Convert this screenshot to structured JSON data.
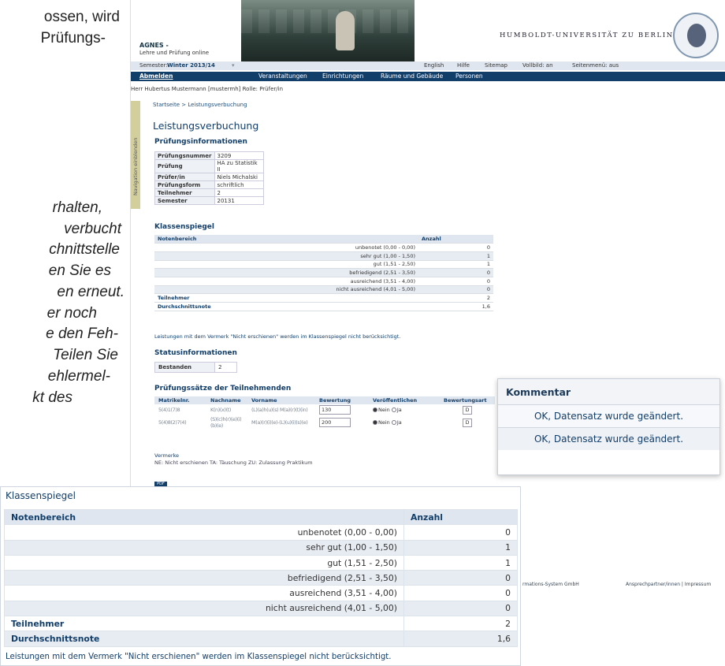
{
  "doc_fragment": {
    "lines": [
      {
        "text": "ossen, wird",
        "style": "normal"
      },
      {
        "text": "Prüfungs-",
        "style": "normal"
      },
      {
        "text": "rhalten,",
        "style": "italic"
      },
      {
        "text": "verbucht",
        "style": "italic"
      },
      {
        "text": "chnittstelle",
        "style": "italic"
      },
      {
        "text": "en Sie es",
        "style": "italic"
      },
      {
        "text": "en erneut.",
        "style": "italic"
      },
      {
        "text": "er noch",
        "style": "italic"
      },
      {
        "text": "e den Feh-",
        "style": "italic"
      },
      {
        "text": "Teilen Sie",
        "style": "italic"
      },
      {
        "text": "ehlermel-",
        "style": "italic"
      },
      {
        "text": "kt des",
        "style": "italic"
      }
    ]
  },
  "header": {
    "app_name": "AGNES -",
    "app_sub": "Lehre und Prüfung online",
    "university": "HUMBOLDT-UNIVERSITÄT ZU BERLIN",
    "semester_label": "Semester:",
    "semester_value": "Winter 2013/14",
    "top_links": [
      "English",
      "Hilfe",
      "Sitemap",
      "Vollbild: an",
      "Seitenmenü: aus"
    ],
    "logout": "Abmelden",
    "nav": [
      "Veranstaltungen",
      "Einrichtungen",
      "Räume und Gebäude",
      "Personen"
    ],
    "user_line": "Herr Hubertus Mustermann [mustermh]  Rolle: Prüfer/in"
  },
  "sidebar_toggle": "Navigation einblenden",
  "breadcrumb": "Startseite > Leistungsverbuchung",
  "page_title": "Leistungsverbuchung",
  "pruefungsinfo": {
    "heading": "Prüfungsinformationen",
    "rows": [
      {
        "k": "Prüfungsnummer",
        "v": "3209"
      },
      {
        "k": "Prüfung",
        "v": "HA zu Statistik II"
      },
      {
        "k": "Prüfer/in",
        "v": "Niels Michalski"
      },
      {
        "k": "Prüfungsform",
        "v": "schriftlich"
      },
      {
        "k": "Teilnehmer",
        "v": "2"
      },
      {
        "k": "Semester",
        "v": "20131"
      }
    ]
  },
  "klassenspiegel": {
    "heading": "Klassenspiegel",
    "col_range": "Notenbereich",
    "col_count": "Anzahl",
    "rows": [
      {
        "range": "unbenotet (0,00 - 0,00)",
        "count": "0"
      },
      {
        "range": "sehr gut (1,00 - 1,50)",
        "count": "1"
      },
      {
        "range": "gut (1,51 - 2,50)",
        "count": "1"
      },
      {
        "range": "befriedigend (2,51 - 3,50)",
        "count": "0"
      },
      {
        "range": "ausreichend (3,51 - 4,00)",
        "count": "0"
      },
      {
        "range": "nicht ausreichend (4,01 - 5,00)",
        "count": "0"
      }
    ],
    "participants_label": "Teilnehmer",
    "participants": "2",
    "avg_label": "Durchschnittsnote",
    "avg": "1,6",
    "note": "Leistungen mit dem Vermerk \"Nicht erschienen\" werden im Klassenspiegel nicht berücksichtigt."
  },
  "status": {
    "heading": "Statusinformationen",
    "label": "Bestanden",
    "value": "2"
  },
  "pruefungssaetze": {
    "heading": "Prüfungssätze der Teilnehmenden",
    "cols": [
      "Matrikelnr.",
      "Nachname",
      "Vorname",
      "Bewertung",
      "Veröffentlichen",
      "Bewertungsart"
    ],
    "rows": [
      {
        "matrikel": "5(4)1(7)8",
        "nachname": "K(n)(x)(t)",
        "vorname": "(L)(a)h(u)(s) M(a)(r)(t)(in)",
        "bewertung": "130"
      },
      {
        "matrikel": "5(4)8(2)7(4)",
        "nachname": "(S)(c)h(r)(e)(i)(b)(e)",
        "vorname": "M(a)(r)(i)(e)-(L)(u)(i)(s)(e)",
        "bewertung": "200"
      }
    ],
    "radio_no": "Nein",
    "radio_yes": "Ja",
    "d_button": "D"
  },
  "vermerke": {
    "title": "Vermerke",
    "legend": "NE: Nicht erschienen   TA: Täuschung   ZU: Zulassung Praktikum"
  },
  "pdf": "PDF",
  "footer": {
    "left": "rmations-System GmbH",
    "right": "Ansprechpartner/innen | Impressum"
  },
  "kommentar": {
    "title": "Kommentar",
    "rows": [
      "OK, Datensatz wurde geändert.",
      "OK, Datensatz wurde geändert."
    ]
  }
}
